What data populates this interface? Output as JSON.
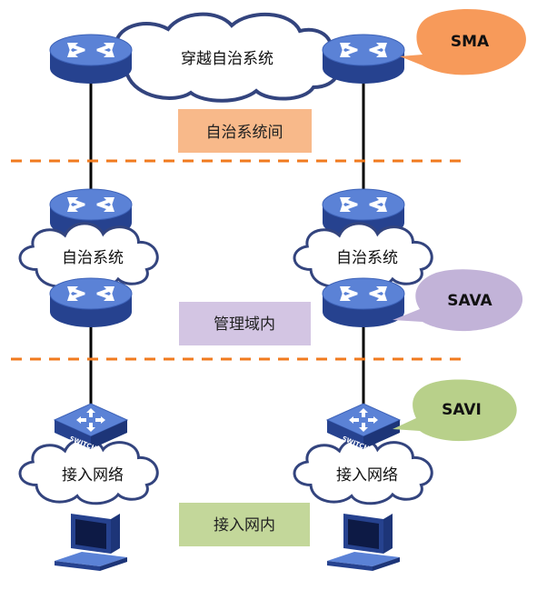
{
  "clouds": {
    "inter_as": "穿越自治系统",
    "as_left": "自治系统",
    "as_right": "自治系统",
    "access_left": "接入网络",
    "access_right": "接入网络"
  },
  "labels": {
    "inter_domain": "自治系统间",
    "intra_domain": "管理域内",
    "access_domain": "接入网内"
  },
  "bubbles": {
    "sma": "SMA",
    "sava": "SAVA",
    "savi": "SAVI"
  },
  "switch_label": "SWITCH",
  "colors": {
    "router_body": "#2f4fa8",
    "router_top": "#5b82d6",
    "link": "#000000",
    "cloud_stroke": "#3a4a8c",
    "divider": "#f07a1e",
    "sma_bubble": "#f79a5a",
    "inter_label_bg": "#f8b98a",
    "sava_bubble": "#c2b3d8",
    "intra_label_bg": "#d3c5e3",
    "savi_bubble": "#b8d08a",
    "access_label_bg": "#c3d79a"
  },
  "icons": [
    "router-icon",
    "switch-icon",
    "computer-icon"
  ]
}
